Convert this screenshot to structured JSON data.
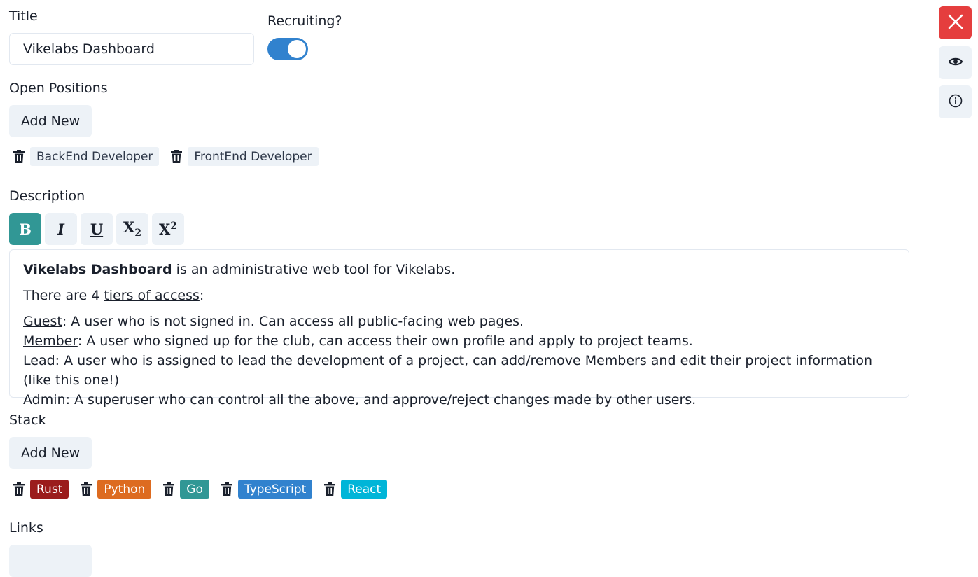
{
  "title_field": {
    "label": "Title",
    "value": "Vikelabs Dashboard"
  },
  "recruiting": {
    "label": "Recruiting?",
    "on": true
  },
  "open_positions": {
    "label": "Open Positions",
    "add_label": "Add New",
    "items": [
      "BackEnd Developer",
      "FrontEnd Developer"
    ]
  },
  "description": {
    "label": "Description",
    "toolbar": {
      "bold": "B",
      "italic": "I",
      "underline": "U",
      "subscript_base": "X",
      "subscript_sub": "2",
      "superscript_base": "X",
      "superscript_sup": "2"
    },
    "content": {
      "line1_bold": "Vikelabs Dashboard",
      "line1_rest": " is an administrative web tool for Vikelabs.",
      "line2_start": "There are 4 ",
      "line2_link": "tiers of access",
      "line2_end": ":",
      "tiers": [
        {
          "name": "Guest",
          "text": ": A user who is not signed in. Can access all public-facing web pages."
        },
        {
          "name": "Member",
          "text": ": A user who signed up for the club, can access their own profile and apply to project teams."
        },
        {
          "name": "Lead",
          "text": ": A user who is assigned to lead the development of a project, can add/remove Members and edit their project information (like this one!)"
        },
        {
          "name": "Admin",
          "text": ": A superuser who can control all the above, and approve/reject changes made by other users."
        }
      ]
    }
  },
  "stack": {
    "label": "Stack",
    "add_label": "Add New",
    "items": [
      {
        "name": "Rust",
        "color": "#9b1c1c"
      },
      {
        "name": "Python",
        "color": "#dd6b20"
      },
      {
        "name": "Go",
        "color": "#319795"
      },
      {
        "name": "TypeScript",
        "color": "#3182ce"
      },
      {
        "name": "React",
        "color": "#00b5d8"
      }
    ]
  },
  "links": {
    "label": "Links"
  },
  "side_actions": {
    "close": {
      "icon": "close-icon",
      "color": "#e53e3e"
    },
    "preview": {
      "icon": "eye-icon"
    },
    "info": {
      "icon": "info-icon"
    }
  },
  "colors": {
    "accent": "#319795",
    "toggle": "#3182ce",
    "danger": "#e53e3e"
  }
}
